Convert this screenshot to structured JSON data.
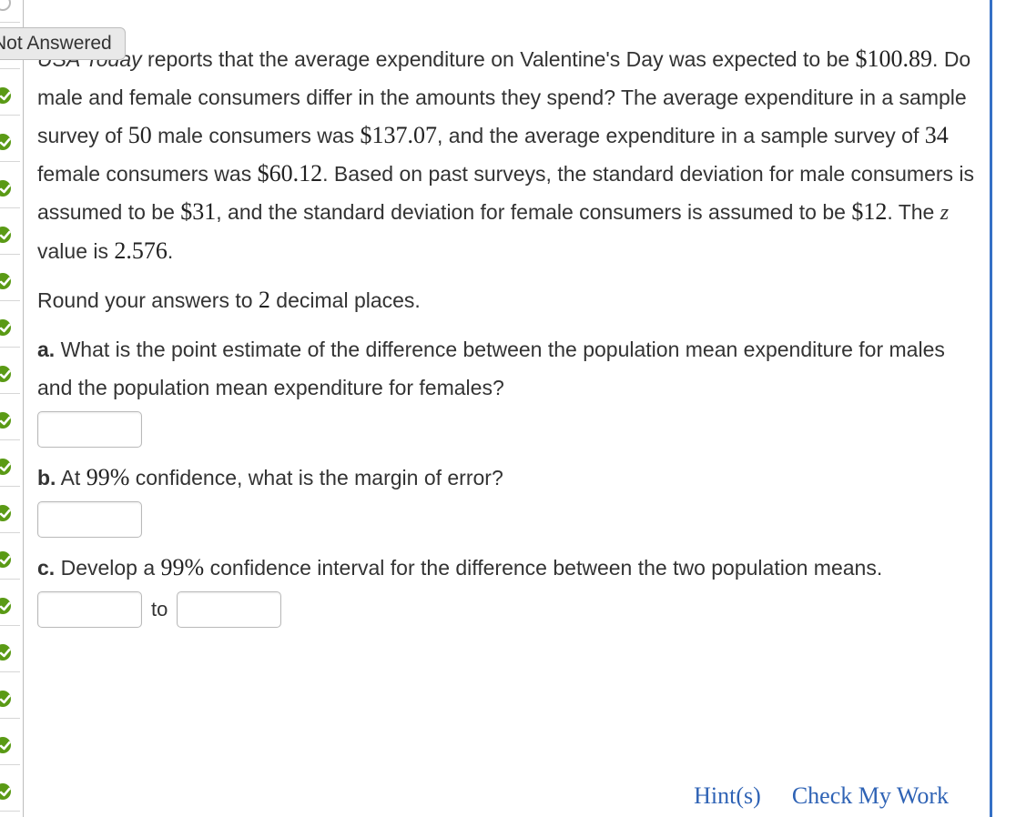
{
  "status_tab": {
    "label": "Not Answered"
  },
  "question": {
    "intro": {
      "source": "USA Today",
      "t1": " reports that the average expenditure on Valentine's Day was expected to be ",
      "v1": "$100.89",
      "t2": ". Do male and female consumers differ in the amounts they spend? The average expenditure in a sample survey of ",
      "v2": "50",
      "t3": " male consumers was ",
      "v3": "$137.07",
      "t4": ", and the average expenditure in a sample survey of ",
      "v4": "34",
      "t5": " female consumers was ",
      "v5": "$60.12",
      "t6": ". Based on past surveys, the standard deviation for male consumers is assumed to be ",
      "v6": "$31",
      "t7": ", and the standard deviation for female consumers is assumed to be ",
      "v7": "$12",
      "t8": ". The ",
      "z": "z",
      "t9": " value is ",
      "v8": "2.576",
      "t10": "."
    },
    "round": {
      "pre": "Round your answers to ",
      "num": "2",
      "post": " decimal places."
    },
    "part_a": {
      "label": "a.",
      "text": " What is the point estimate of the difference between the population mean expenditure for males and the population mean expenditure for females?",
      "answer": ""
    },
    "part_b": {
      "label": "b.",
      "pre": " At ",
      "pct": "99%",
      "post": " confidence, what is the margin of error?",
      "answer": ""
    },
    "part_c": {
      "label": "c.",
      "pre": " Develop a ",
      "pct": "99%",
      "post": " confidence interval for the difference between the two population means.",
      "answer_low": "",
      "to_label": "to",
      "answer_high": ""
    }
  },
  "footer": {
    "hint_label": "Hint(s)",
    "check_label": "Check My Work"
  },
  "sidebar": {
    "items": [
      {
        "state": "open"
      },
      {
        "state": "done"
      },
      {
        "state": "done"
      },
      {
        "state": "done"
      },
      {
        "state": "done"
      },
      {
        "state": "done"
      },
      {
        "state": "done"
      },
      {
        "state": "done"
      },
      {
        "state": "done"
      },
      {
        "state": "done"
      },
      {
        "state": "done"
      },
      {
        "state": "done"
      },
      {
        "state": "done"
      },
      {
        "state": "done"
      },
      {
        "state": "done"
      },
      {
        "state": "done"
      },
      {
        "state": "done"
      },
      {
        "state": "done"
      }
    ]
  },
  "colors": {
    "accent": "#3570c6",
    "link": "#2f63b5",
    "check_green": "#5a9a15",
    "text": "#333333"
  }
}
